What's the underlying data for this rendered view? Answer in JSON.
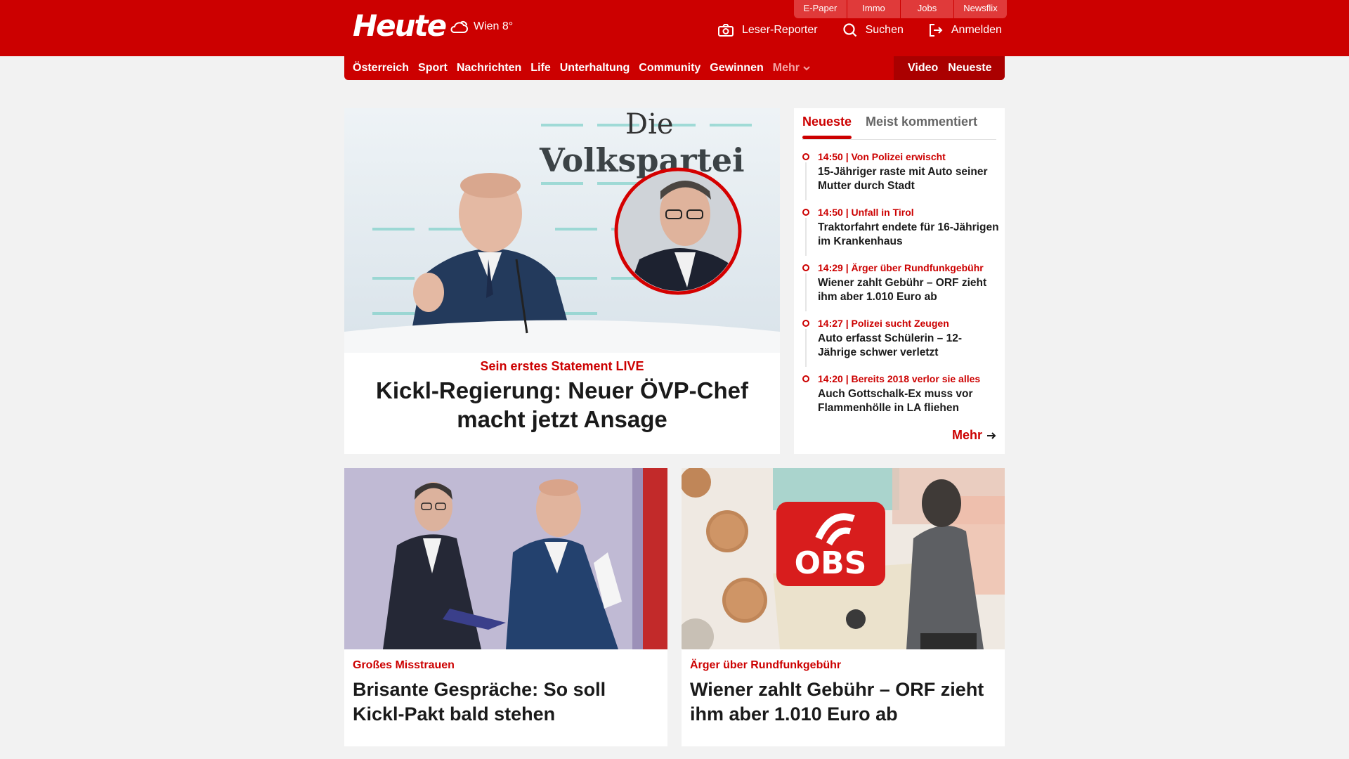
{
  "brand": {
    "logo": "Heute",
    "weather": "Wien 8°",
    "accent": "#cc0000"
  },
  "topbar": [
    "E-Paper",
    "Immo",
    "Jobs",
    "Newsflix"
  ],
  "header_actions": {
    "reporter": "Leser-Reporter",
    "search": "Suchen",
    "login": "Anmelden"
  },
  "nav": {
    "items": [
      "Österreich",
      "Sport",
      "Nachrichten",
      "Life",
      "Unterhaltung",
      "Community",
      "Gewinnen"
    ],
    "more": "Mehr",
    "video": "Video",
    "latest": "Neueste"
  },
  "hero": {
    "image_text_die": "Die",
    "image_text_party": "Volkspartei",
    "kicker": "Sein erstes Statement LIVE",
    "title": "Kickl-Regierung: Neuer ÖVP-Chef macht jetzt Ansage"
  },
  "sidebar": {
    "tab_active": "Neueste",
    "tab_inactive": "Meist kommentiert",
    "items": [
      {
        "meta": "14:50 | Von Polizei erwischt",
        "title": "15-Jähriger raste mit Auto seiner Mutter durch Stadt"
      },
      {
        "meta": "14:50 | Unfall in Tirol",
        "title": "Traktorfahrt endete für 16-Jährigen im Krankenhaus"
      },
      {
        "meta": "14:29 | Ärger über Rundfunkgebühr",
        "title": "Wiener zahlt Gebühr – ORF zieht ihm aber 1.010 Euro ab"
      },
      {
        "meta": "14:27 | Polizei sucht Zeugen",
        "title": "Auto erfasst Schülerin – 12-Jährige schwer verletzt"
      },
      {
        "meta": "14:20 | Bereits 2018 verlor sie alles",
        "title": "Auch Gottschalk-Ex muss vor Flammenhölle in LA fliehen"
      }
    ],
    "more": "Mehr"
  },
  "cards": [
    {
      "kicker": "Großes Misstrauen",
      "title": "Brisante Gespräche: So soll Kickl-Pakt bald stehen"
    },
    {
      "kicker": "Ärger über Rundfunkgebühr",
      "title": "Wiener zahlt Gebühr – ORF zieht ihm aber 1.010 Euro ab",
      "image_text": "OBS"
    }
  ]
}
